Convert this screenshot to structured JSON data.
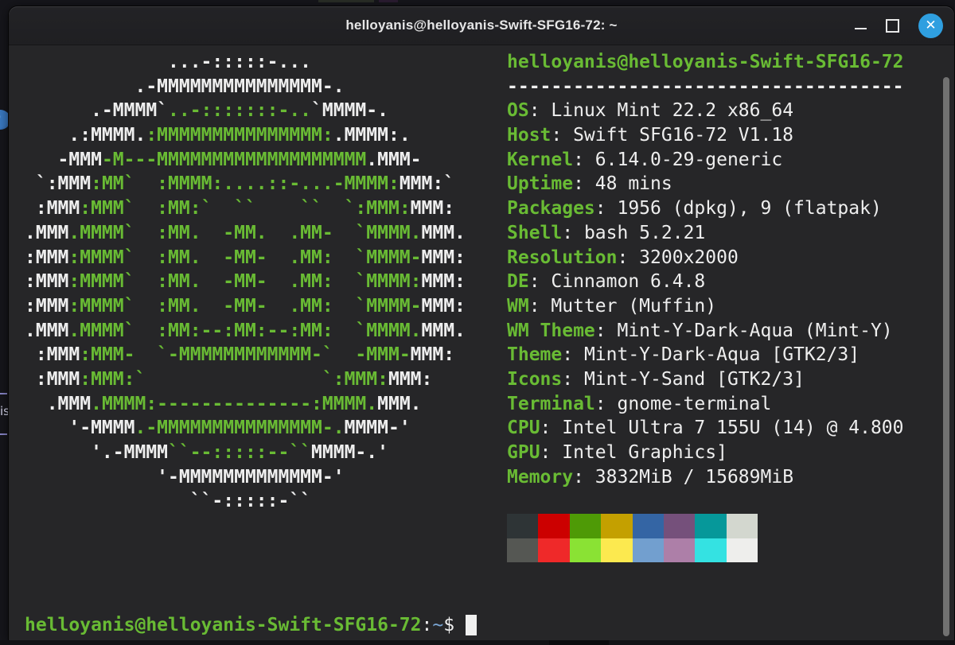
{
  "window": {
    "title": "helloyanis@helloyanis-Swift-SFG16-72: ~",
    "controls": {
      "minimize": "minimize",
      "maximize": "maximize",
      "close_glyph": "✕"
    }
  },
  "colors": {
    "fg": "#eeeeee",
    "green": "#69bb34",
    "blue": "#7aa6d4",
    "term-bg": "#262628",
    "titlebar-bg": "#232326",
    "close-blue": "#2f9fe0",
    "scrollbar": "#717171",
    "desktop": "#16161b"
  },
  "desktop": {
    "icon_label_fragment": "is"
  },
  "logo": {
    "lines": [
      [
        {
          "c": "c1",
          "t": "             ...-:::::-..."
        }
      ],
      [
        {
          "c": "c1",
          "t": "          .-MMMMMMMMMMMMMMM-."
        }
      ],
      [
        {
          "c": "c1",
          "t": "      .-MMMM`"
        },
        {
          "c": "c2",
          "t": "..-:::::::-.."
        },
        {
          "c": "c1",
          "t": "`MMMM-."
        }
      ],
      [
        {
          "c": "c1",
          "t": "    .:MMMM."
        },
        {
          "c": "c2",
          "t": ":MMMMMMMMMMMMMMM:"
        },
        {
          "c": "c1",
          "t": ".MMMM:."
        }
      ],
      [
        {
          "c": "c1",
          "t": "   -MMM"
        },
        {
          "c": "c2",
          "t": "-M---MMMMMMMMMMMMMMMMMMM"
        },
        {
          "c": "c1",
          "t": ".MMM-"
        }
      ],
      [
        {
          "c": "c1",
          "t": " `:MMM"
        },
        {
          "c": "c2",
          "t": ":MM`  :MMMM:....::-...-MMMM:"
        },
        {
          "c": "c1",
          "t": "MMM:`"
        }
      ],
      [
        {
          "c": "c1",
          "t": " :MMM"
        },
        {
          "c": "c2",
          "t": ":MMM`  :MM:`  ``    ``  `:MMM:"
        },
        {
          "c": "c1",
          "t": "MMM:"
        }
      ],
      [
        {
          "c": "c1",
          "t": ".MMM"
        },
        {
          "c": "c2",
          "t": ".MMMM`  :MM.  -MM.  .MM-  `MMMM."
        },
        {
          "c": "c1",
          "t": "MMM."
        }
      ],
      [
        {
          "c": "c1",
          "t": ":MMM"
        },
        {
          "c": "c2",
          "t": ":MMMM`  :MM.  -MM-  .MM:  `MMMM-"
        },
        {
          "c": "c1",
          "t": "MMM:"
        }
      ],
      [
        {
          "c": "c1",
          "t": ":MMM"
        },
        {
          "c": "c2",
          "t": ":MMMM`  :MM.  -MM-  .MM:  `MMMM:"
        },
        {
          "c": "c1",
          "t": "MMM:"
        }
      ],
      [
        {
          "c": "c1",
          "t": ":MMM"
        },
        {
          "c": "c2",
          "t": ":MMMM`  :MM.  -MM-  .MM:  `MMMM-"
        },
        {
          "c": "c1",
          "t": "MMM:"
        }
      ],
      [
        {
          "c": "c1",
          "t": ".MMM"
        },
        {
          "c": "c2",
          "t": ".MMMM`  :MM:--:MM:--:MM:  `MMMM."
        },
        {
          "c": "c1",
          "t": "MMM."
        }
      ],
      [
        {
          "c": "c1",
          "t": " :MMM"
        },
        {
          "c": "c2",
          "t": ":MMM-  `-MMMMMMMMMMMM-`  -MMM-"
        },
        {
          "c": "c1",
          "t": "MMM:"
        }
      ],
      [
        {
          "c": "c1",
          "t": " :MMM"
        },
        {
          "c": "c2",
          "t": ":MMM:`                `:MMM:"
        },
        {
          "c": "c1",
          "t": "MMM:"
        }
      ],
      [
        {
          "c": "c1",
          "t": "  .MMM"
        },
        {
          "c": "c2",
          "t": ".MMMM:--------------:MMMM."
        },
        {
          "c": "c1",
          "t": "MMM."
        }
      ],
      [
        {
          "c": "c1",
          "t": "    '-MMMM"
        },
        {
          "c": "c2",
          "t": ".-MMMMMMMMMMMMMMM-."
        },
        {
          "c": "c1",
          "t": "MMMM-'"
        }
      ],
      [
        {
          "c": "c1",
          "t": "      '.-MMMM"
        },
        {
          "c": "c2",
          "t": "``--:::::--``"
        },
        {
          "c": "c1",
          "t": "MMMM-.'"
        }
      ],
      [
        {
          "c": "c1",
          "t": "            '-MMMMMMMMMMMMM-'"
        }
      ],
      [
        {
          "c": "c1",
          "t": "               ``-:::::-``"
        }
      ]
    ]
  },
  "info": {
    "title": "helloyanis@helloyanis-Swift-SFG16-72",
    "separator": "------------------------------------",
    "label_suffix": ": ",
    "entries": [
      {
        "label": "OS",
        "value": "Linux Mint 22.2 x86_64"
      },
      {
        "label": "Host",
        "value": "Swift SFG16-72 V1.18"
      },
      {
        "label": "Kernel",
        "value": "6.14.0-29-generic"
      },
      {
        "label": "Uptime",
        "value": "48 mins"
      },
      {
        "label": "Packages",
        "value": "1956 (dpkg), 9 (flatpak)"
      },
      {
        "label": "Shell",
        "value": "bash 5.2.21"
      },
      {
        "label": "Resolution",
        "value": "3200x2000"
      },
      {
        "label": "DE",
        "value": "Cinnamon 6.4.8"
      },
      {
        "label": "WM",
        "value": "Mutter (Muffin)"
      },
      {
        "label": "WM Theme",
        "value": "Mint-Y-Dark-Aqua (Mint-Y)"
      },
      {
        "label": "Theme",
        "value": "Mint-Y-Dark-Aqua [GTK2/3]"
      },
      {
        "label": "Icons",
        "value": "Mint-Y-Sand [GTK2/3]"
      },
      {
        "label": "Terminal",
        "value": "gnome-terminal"
      },
      {
        "label": "CPU",
        "value": "Intel Ultra 7 155U (14) @ 4.800"
      },
      {
        "label": "GPU",
        "value": "Intel Graphics]"
      },
      {
        "label": "Memory",
        "value": "3832MiB / 15689MiB"
      }
    ]
  },
  "palette": {
    "normal": [
      "#2e3436",
      "#cc0000",
      "#4e9a06",
      "#c4a000",
      "#3465a4",
      "#75507b",
      "#06989a",
      "#d3d7cf"
    ],
    "bright": [
      "#555753",
      "#ef2929",
      "#8ae234",
      "#fce94f",
      "#729fcf",
      "#ad7fa8",
      "#34e2e2",
      "#eeeeec"
    ]
  },
  "prompt": {
    "user_host": "helloyanis@helloyanis-Swift-SFG16-72",
    "colon": ":",
    "path": "~",
    "symbol": "$"
  }
}
